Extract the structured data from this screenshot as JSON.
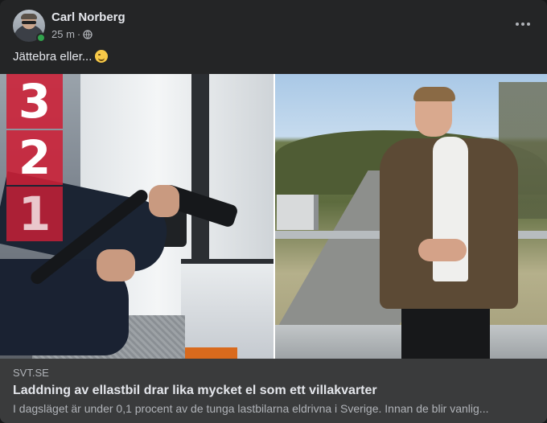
{
  "post": {
    "author": "Carl Norberg",
    "time": "25 m",
    "separator": "·",
    "privacy_icon": "globe-icon",
    "text": "Jättebra eller...",
    "emoji": "smirk-emoji"
  },
  "media": {
    "countdown": [
      "3",
      "2",
      "1"
    ],
    "countdown_color": "#cd2037"
  },
  "link_preview": {
    "domain": "SVT.SE",
    "title": "Laddning av ellastbil drar lika mycket el som ett villakvarter",
    "description": "I dagsläget är under 0,1 procent av de tunga lastbilarna eldrivna i Sverige. Innan de blir vanlig..."
  },
  "colors": {
    "card_bg": "#242526",
    "footer_bg": "#3a3b3c",
    "online": "#31a24c"
  }
}
